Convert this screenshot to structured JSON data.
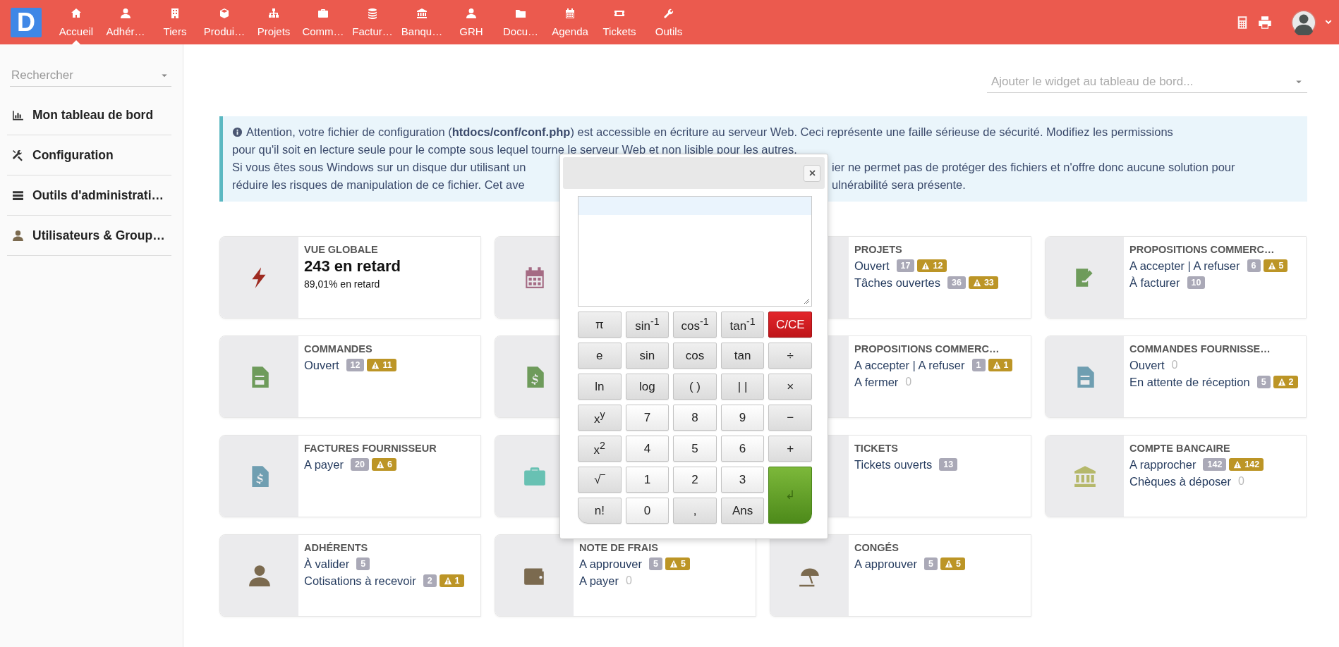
{
  "topbar": {
    "logo": "D",
    "nav": [
      {
        "label": "Accueil",
        "selected": true
      },
      {
        "label": "Adhér…",
        "selected": false
      },
      {
        "label": "Tiers",
        "selected": false
      },
      {
        "label": "Produi…",
        "selected": false
      },
      {
        "label": "Projets",
        "selected": false
      },
      {
        "label": "Comm…",
        "selected": false
      },
      {
        "label": "Factur…",
        "selected": false
      },
      {
        "label": "Banqu…",
        "selected": false
      },
      {
        "label": "GRH",
        "selected": false
      },
      {
        "label": "Docu…",
        "selected": false
      },
      {
        "label": "Agenda",
        "selected": false
      },
      {
        "label": "Tickets",
        "selected": false
      },
      {
        "label": "Outils",
        "selected": false
      }
    ]
  },
  "sidebar": {
    "search": {
      "placeholder": "Rechercher"
    },
    "items": [
      {
        "label": "Mon tableau de bord"
      },
      {
        "label": "Configuration"
      },
      {
        "label": "Outils d'administrati…"
      },
      {
        "label": "Utilisateurs & Group…"
      }
    ]
  },
  "widget_select": {
    "placeholder": "Ajouter le widget au tableau de bord..."
  },
  "alert": {
    "lines": [
      {
        "kind": "full",
        "text": "Attention, votre fichier de configuration (**htdocs/conf/conf.php**) est accessible en écriture au serveur Web. Ceci représente une faille sérieuse de sécurité. Modifiez les permissions"
      },
      {
        "kind": "full",
        "text": "pour qu'il soit en lecture seule pour le compte sous lequel tourne le serveur Web et non lisible pour les autres."
      },
      {
        "kind": "split",
        "left": "Si vous êtes sous Windows sur un disque dur utilisant un",
        "right": "ier ne permet pas de protéger des fichiers et n'offre donc aucune solution pour"
      },
      {
        "kind": "split",
        "left": "réduire les risques de manipulation de ce fichier. Cet ave",
        "right": "ulnérabilité sera présente."
      }
    ]
  },
  "cards": [
    {
      "kind": "stat",
      "title": "VUE GLOBALE",
      "value": "243 en retard",
      "sub": "89,01% en retard"
    },
    {
      "kind": "covered"
    },
    {
      "kind": "list",
      "title": "PROJETS",
      "lines": [
        {
          "label": "Ouvert",
          "count": "17",
          "empty": false,
          "warning": "12"
        },
        {
          "label": "Tâches ouvertes",
          "count": "36",
          "empty": false,
          "warning": "33"
        }
      ]
    },
    {
      "kind": "list",
      "title": "PROPOSITIONS COMMERC…",
      "lines": [
        {
          "label": "A accepter | A refuser",
          "count": "6",
          "empty": false,
          "warning": "5"
        },
        {
          "label": "À facturer",
          "count": "10",
          "empty": false
        }
      ]
    },
    {
      "kind": "list",
      "title": "COMMANDES",
      "lines": [
        {
          "label": "Ouvert",
          "count": "12",
          "empty": false,
          "warning": "11"
        }
      ]
    },
    {
      "kind": "covered"
    },
    {
      "kind": "list",
      "title": "PROPOSITIONS COMMERC…",
      "lines": [
        {
          "label": "A accepter | A refuser",
          "count": "1",
          "empty": false,
          "warning": "1"
        },
        {
          "label": "A fermer",
          "count": "0",
          "empty": true
        }
      ]
    },
    {
      "kind": "list",
      "title": "COMMANDES FOURNISSE…",
      "lines": [
        {
          "label": "Ouvert",
          "count": "0",
          "empty": true
        },
        {
          "label": "En attente de réception",
          "count": "5",
          "empty": false,
          "warning": "2"
        }
      ]
    },
    {
      "kind": "list",
      "title": "FACTURES FOURNISSEUR",
      "lines": [
        {
          "label": "A payer",
          "count": "20",
          "empty": false,
          "warning": "6"
        }
      ]
    },
    {
      "kind": "covered"
    },
    {
      "kind": "list",
      "title": "TICKETS",
      "lines": [
        {
          "label": "Tickets ouverts",
          "count": "13",
          "empty": false
        }
      ]
    },
    {
      "kind": "list",
      "title": "COMPTE BANCAIRE",
      "lines": [
        {
          "label": "A rapprocher",
          "count": "142",
          "empty": false,
          "warning": "142"
        },
        {
          "label": "Chèques à déposer",
          "count": "0",
          "empty": true
        }
      ]
    },
    {
      "kind": "list",
      "title": "ADHÉRENTS",
      "lines": [
        {
          "label": "À valider",
          "count": "5",
          "empty": false
        },
        {
          "label": "Cotisations à recevoir",
          "count": "2",
          "empty": false,
          "warning": "1"
        }
      ]
    },
    {
      "kind": "list",
      "title": "NOTE DE FRAIS",
      "lines": [
        {
          "label": "A approuver",
          "count": "5",
          "empty": false,
          "warning": "5"
        },
        {
          "label": "A payer",
          "count": "0",
          "empty": true
        }
      ]
    },
    {
      "kind": "list",
      "title": "CONGÉS",
      "lines": [
        {
          "label": "A approuver",
          "count": "5",
          "empty": false,
          "warning": "5"
        }
      ]
    }
  ],
  "calculator": {
    "keys": [
      {
        "label": "π",
        "kind": "fn"
      },
      {
        "label": "sin$^{-1}$",
        "kind": "fn"
      },
      {
        "label": "cos$^{-1}$",
        "kind": "fn"
      },
      {
        "label": "tan$^{-1}$",
        "kind": "fn"
      },
      {
        "label": "C/CE",
        "kind": "clear"
      },
      {
        "label": "e",
        "kind": "fn"
      },
      {
        "label": "sin",
        "kind": "fn"
      },
      {
        "label": "cos",
        "kind": "fn"
      },
      {
        "label": "tan",
        "kind": "fn"
      },
      {
        "label": "÷",
        "kind": "fn"
      },
      {
        "label": "ln",
        "kind": "fn"
      },
      {
        "label": "log",
        "kind": "fn"
      },
      {
        "label": "( )",
        "kind": "fn"
      },
      {
        "label": "| |",
        "kind": "fn"
      },
      {
        "label": "×",
        "kind": "fn"
      },
      {
        "label": "x$^{y}$",
        "kind": "fn"
      },
      {
        "label": "7",
        "kind": "num"
      },
      {
        "label": "8",
        "kind": "num"
      },
      {
        "label": "9",
        "kind": "num"
      },
      {
        "label": "−",
        "kind": "fn"
      },
      {
        "label": "x$^{2}$",
        "kind": "fn"
      },
      {
        "label": "4",
        "kind": "num"
      },
      {
        "label": "5",
        "kind": "num"
      },
      {
        "label": "6",
        "kind": "num"
      },
      {
        "label": "+",
        "kind": "fn"
      },
      {
        "label": "√‾",
        "kind": "fn"
      },
      {
        "label": "1",
        "kind": "num"
      },
      {
        "label": "2",
        "kind": "num"
      },
      {
        "label": "3",
        "kind": "num"
      },
      {
        "label": "↲",
        "kind": "enter"
      },
      {
        "label": "n!",
        "kind": "fn"
      },
      {
        "label": "0",
        "kind": "num"
      },
      {
        "label": ",",
        "kind": "fn"
      },
      {
        "label": "Ans",
        "kind": "fn"
      }
    ]
  }
}
